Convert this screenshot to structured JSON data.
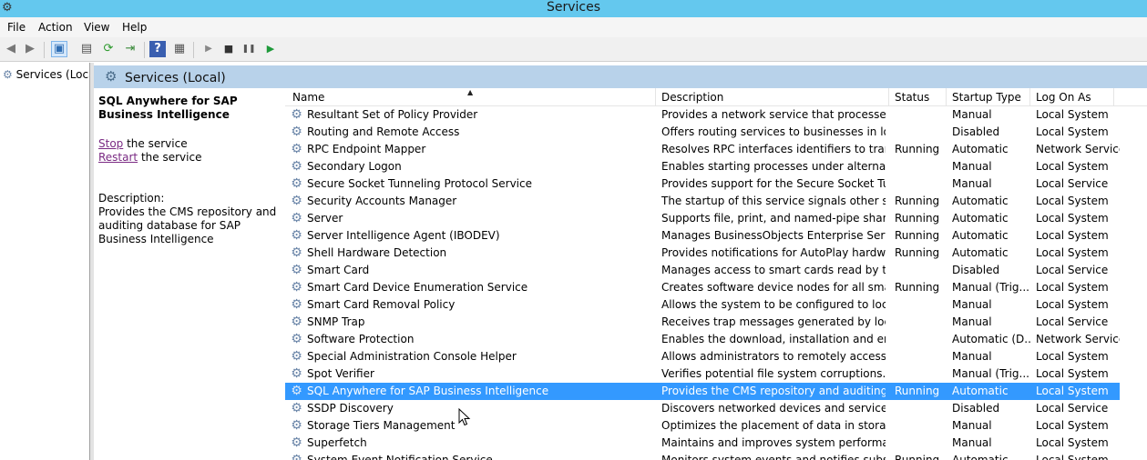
{
  "window": {
    "title": "Services",
    "app_icon": "gear-icon"
  },
  "menu": [
    "File",
    "Action",
    "View",
    "Help"
  ],
  "toolbar": [
    {
      "name": "back-button",
      "glyph": "◀"
    },
    {
      "name": "forward-button",
      "glyph": "▶"
    },
    {
      "name": "show-hide-console-tree-button",
      "glyph": "▣"
    },
    {
      "name": "properties-button",
      "glyph": "▤"
    },
    {
      "name": "refresh-button",
      "glyph": "⟳"
    },
    {
      "name": "export-list-button",
      "glyph": "⇥"
    },
    {
      "name": "help-button",
      "glyph": "?"
    },
    {
      "name": "show-action-pane-button",
      "glyph": "▦"
    },
    {
      "name": "start-service-button",
      "glyph": "▶"
    },
    {
      "name": "stop-service-button",
      "glyph": "■"
    },
    {
      "name": "pause-service-button",
      "glyph": "❚❚"
    },
    {
      "name": "restart-service-button",
      "glyph": "▶"
    }
  ],
  "tree": {
    "item": "Services (Local)",
    "icon": "gear-icon"
  },
  "content_header": {
    "title": "Services (Local)",
    "icon": "gear-icon"
  },
  "description_pane": {
    "service_title": "SQL Anywhere for SAP Business Intelligence",
    "stop_link": "Stop",
    "stop_suffix": " the service",
    "restart_link": "Restart",
    "restart_suffix": " the service",
    "description_label": "Description:",
    "description_text": "Provides the CMS repository and auditing database for SAP Business Intelligence"
  },
  "columns": {
    "name": "Name",
    "description": "Description",
    "status": "Status",
    "startup_type": "Startup Type",
    "log_on_as": "Log On As"
  },
  "services": [
    {
      "name": "Resultant Set of Policy Provider",
      "description": "Provides a network service that processes re...",
      "status": "",
      "startup": "Manual",
      "logon": "Local System"
    },
    {
      "name": "Routing and Remote Access",
      "description": "Offers routing services to businesses in local ...",
      "status": "",
      "startup": "Disabled",
      "logon": "Local System"
    },
    {
      "name": "RPC Endpoint Mapper",
      "description": "Resolves RPC interfaces identifiers to transp...",
      "status": "Running",
      "startup": "Automatic",
      "logon": "Network Service"
    },
    {
      "name": "Secondary Logon",
      "description": "Enables starting processes under alternate cr...",
      "status": "",
      "startup": "Manual",
      "logon": "Local System"
    },
    {
      "name": "Secure Socket Tunneling Protocol Service",
      "description": "Provides support for the Secure Socket Tunn...",
      "status": "",
      "startup": "Manual",
      "logon": "Local Service"
    },
    {
      "name": "Security Accounts Manager",
      "description": "The startup of this service signals other servi...",
      "status": "Running",
      "startup": "Automatic",
      "logon": "Local System"
    },
    {
      "name": "Server",
      "description": "Supports file, print, and named-pipe sharing...",
      "status": "Running",
      "startup": "Automatic",
      "logon": "Local System"
    },
    {
      "name": "Server Intelligence Agent (IBODEV)",
      "description": "Manages BusinessObjects Enterprise Servers",
      "status": "Running",
      "startup": "Automatic",
      "logon": "Local System"
    },
    {
      "name": "Shell Hardware Detection",
      "description": "Provides notifications for AutoPlay hardware...",
      "status": "Running",
      "startup": "Automatic",
      "logon": "Local System"
    },
    {
      "name": "Smart Card",
      "description": "Manages access to smart cards read by this ...",
      "status": "",
      "startup": "Disabled",
      "logon": "Local Service"
    },
    {
      "name": "Smart Card Device Enumeration Service",
      "description": "Creates software device nodes for all smart c...",
      "status": "Running",
      "startup": "Manual (Trig...",
      "logon": "Local System"
    },
    {
      "name": "Smart Card Removal Policy",
      "description": "Allows the system to be configured to lock t...",
      "status": "",
      "startup": "Manual",
      "logon": "Local System"
    },
    {
      "name": "SNMP Trap",
      "description": "Receives trap messages generated by local o...",
      "status": "",
      "startup": "Manual",
      "logon": "Local Service"
    },
    {
      "name": "Software Protection",
      "description": "Enables the download, installation and enfor...",
      "status": "",
      "startup": "Automatic (D...",
      "logon": "Network Service"
    },
    {
      "name": "Special Administration Console Helper",
      "description": "Allows administrators to remotely access a c...",
      "status": "",
      "startup": "Manual",
      "logon": "Local System"
    },
    {
      "name": "Spot Verifier",
      "description": "Verifies potential file system corruptions.",
      "status": "",
      "startup": "Manual (Trig...",
      "logon": "Local System"
    },
    {
      "name": "SQL Anywhere for SAP Business Intelligence",
      "description": "Provides the CMS repository and auditing da...",
      "status": "Running",
      "startup": "Automatic",
      "logon": "Local System",
      "selected": true
    },
    {
      "name": "SSDP Discovery",
      "description": "Discovers networked devices and services th...",
      "status": "",
      "startup": "Disabled",
      "logon": "Local Service"
    },
    {
      "name": "Storage Tiers Management",
      "description": "Optimizes the placement of data in storage t...",
      "status": "",
      "startup": "Manual",
      "logon": "Local System"
    },
    {
      "name": "Superfetch",
      "description": "Maintains and improves system performanc...",
      "status": "",
      "startup": "Manual",
      "logon": "Local System"
    },
    {
      "name": "System Event Notification Service",
      "description": "Monitors system events and notifies subscri...",
      "status": "Running",
      "startup": "Automatic",
      "logon": "Local System"
    }
  ],
  "colors": {
    "titlebar": "#64c8ee",
    "selection": "#3399ff",
    "link": "#7a2a83"
  }
}
